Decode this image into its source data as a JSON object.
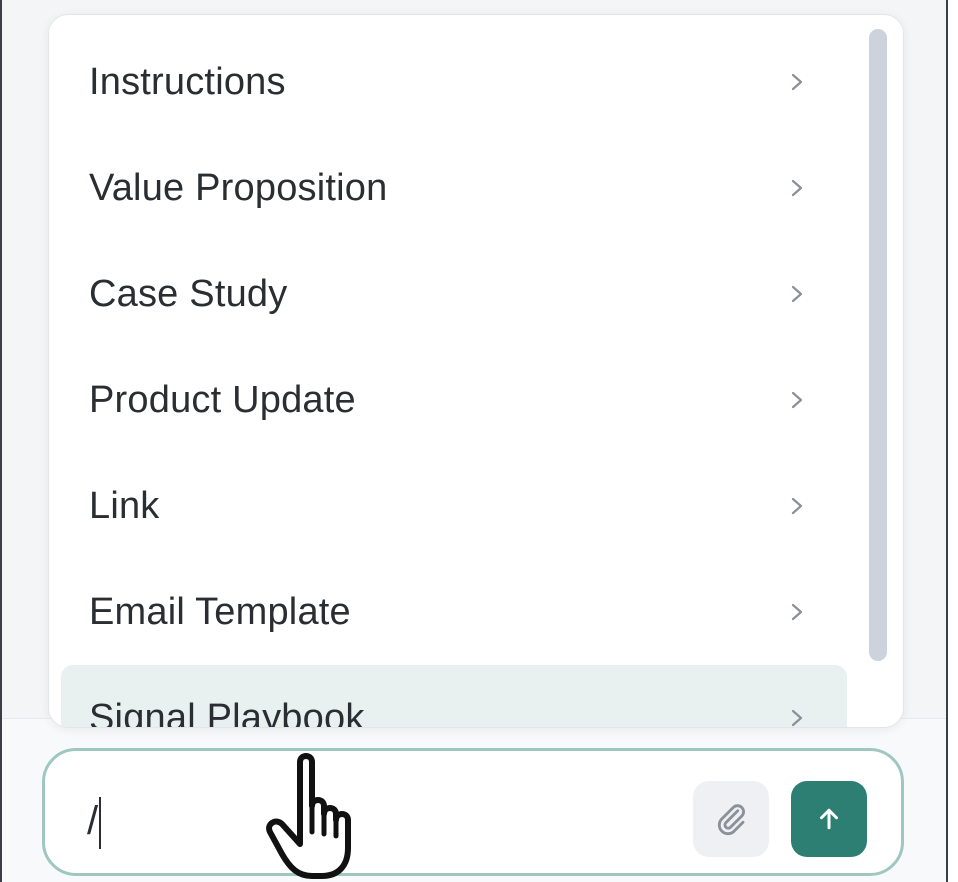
{
  "menu": {
    "items": [
      {
        "label": "Instructions"
      },
      {
        "label": "Value Proposition"
      },
      {
        "label": "Case Study"
      },
      {
        "label": "Product Update"
      },
      {
        "label": "Link"
      },
      {
        "label": "Email Template"
      },
      {
        "label": "Signal Playbook"
      }
    ],
    "chevron_icon": "chevron-right-icon",
    "highlight_color": "#e8f1f0"
  },
  "composer": {
    "value": "/",
    "attach_icon": "paperclip-icon",
    "send_icon": "arrow-up-icon",
    "accent_color": "#2d7f73",
    "border_color": "#9fc7bf"
  },
  "pointer": {
    "icon": "hand-pointer-cursor-icon"
  }
}
